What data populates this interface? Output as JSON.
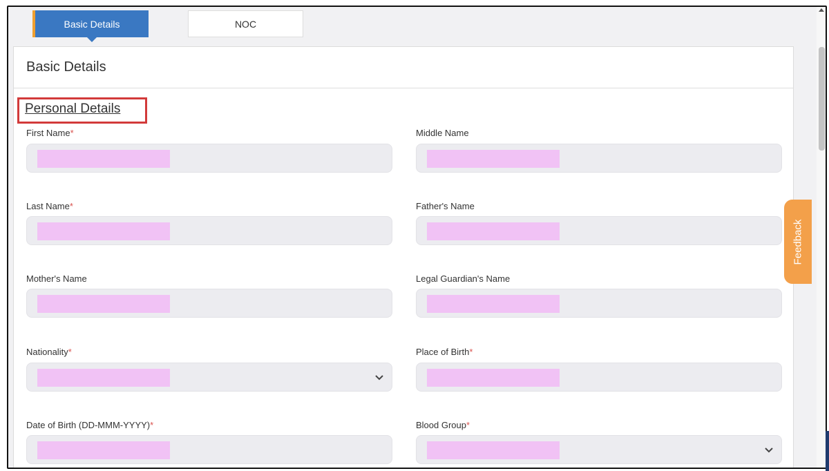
{
  "tabs": [
    {
      "label": "Basic Details",
      "active": true
    },
    {
      "label": "NOC",
      "active": false
    }
  ],
  "card": {
    "title": "Basic Details",
    "section_title": "Personal Details"
  },
  "fields": {
    "first_name": {
      "label": "First Name",
      "required": "*"
    },
    "middle_name": {
      "label": "Middle Name"
    },
    "last_name": {
      "label": "Last Name",
      "required": "*"
    },
    "fathers_name": {
      "label": "Father's Name"
    },
    "mothers_name": {
      "label": "Mother's Name"
    },
    "guardian_name": {
      "label": "Legal Guardian's Name"
    },
    "nationality": {
      "label": "Nationality",
      "required": "*",
      "type": "select"
    },
    "place_of_birth": {
      "label": "Place of Birth",
      "required": "*"
    },
    "date_of_birth": {
      "label": "Date of Birth (DD-MMM-YYYY)",
      "required": "*"
    },
    "blood_group": {
      "label": "Blood Group",
      "required": "*",
      "type": "select"
    }
  },
  "feedback": {
    "label": "Feedback"
  },
  "colors": {
    "tab_active": "#3a78c2",
    "tab_accent": "#f0a030",
    "required": "#d9534f",
    "highlight_box": "#d23a3a",
    "feedback": "#f3a04a",
    "redaction": "#f1c2f5"
  },
  "icons": {
    "select_chevron": "chevron-down-icon",
    "scroll_up": "arrow-up-icon"
  }
}
